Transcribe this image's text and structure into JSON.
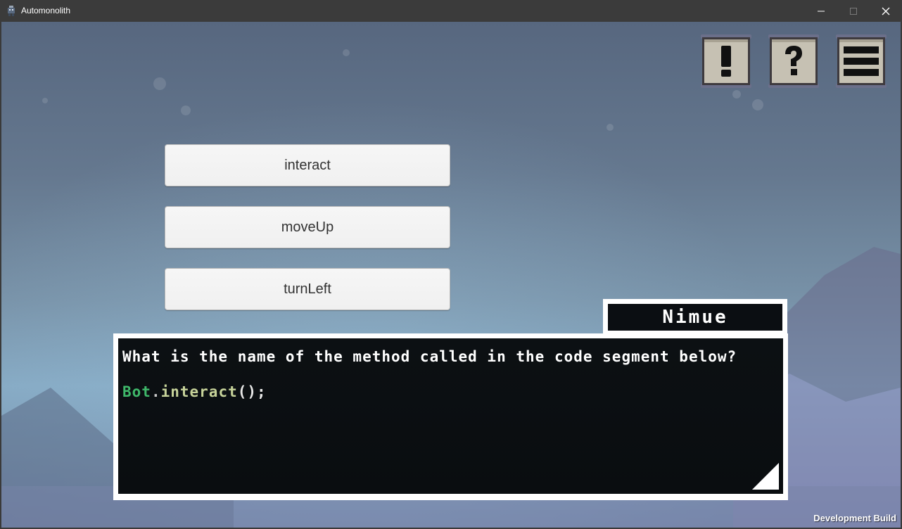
{
  "window": {
    "title": "Automonolith",
    "controls": {
      "minimize": "—",
      "maximize": "☐",
      "close": "✕"
    }
  },
  "hud": {
    "alert_icon": "exclamation-icon",
    "help_icon": "question-icon",
    "menu_icon": "hamburger-menu-icon"
  },
  "answers": [
    {
      "label": "interact"
    },
    {
      "label": "moveUp"
    },
    {
      "label": "turnLeft"
    }
  ],
  "dialog": {
    "speaker": "Nimue",
    "question": "What is the name of the method called in the code segment below?",
    "code": {
      "object": "Bot",
      "dot": ".",
      "method": "interact",
      "suffix": "();"
    },
    "next_icon": "continue-arrow-icon"
  },
  "footer": {
    "build_label": "Development Build"
  },
  "colors": {
    "code_object": "#3fb86a",
    "code_method": "#c7d39a",
    "dialog_bg": "#0b0e12",
    "dialog_border": "#ffffff"
  }
}
